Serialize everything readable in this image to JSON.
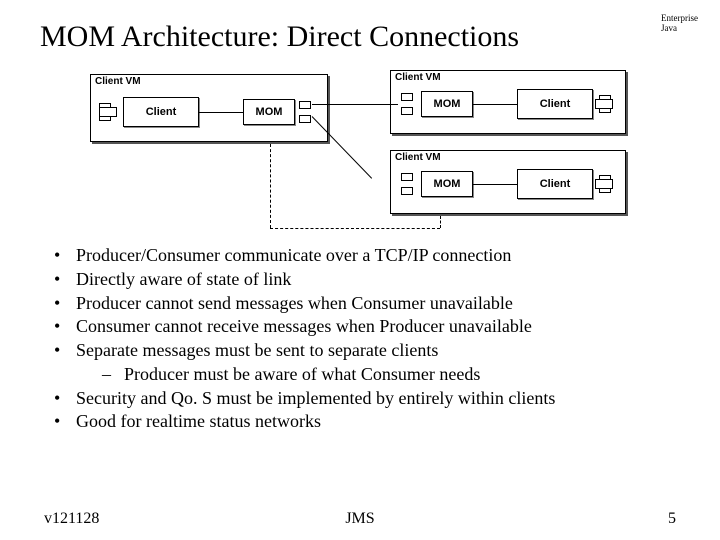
{
  "title": "MOM Architecture: Direct Connections",
  "corner": {
    "line1": "Enterprise",
    "line2": "Java"
  },
  "diagram": {
    "vm_label": "Client VM",
    "client_label": "Client",
    "mom_label": "MOM"
  },
  "bullets": [
    "Producer/Consumer communicate over a TCP/IP connection",
    "Directly aware of state of link",
    "Producer cannot send messages when Consumer unavailable",
    "Consumer cannot receive messages when Producer unavailable",
    "Separate messages must be sent to separate clients",
    "Security and Qo. S must be implemented by entirely within clients",
    "Good for realtime status networks"
  ],
  "sub_bullets": [
    "Producer must be aware of what Consumer needs"
  ],
  "footer": {
    "left": "v121128",
    "center": "JMS",
    "right": "5"
  }
}
